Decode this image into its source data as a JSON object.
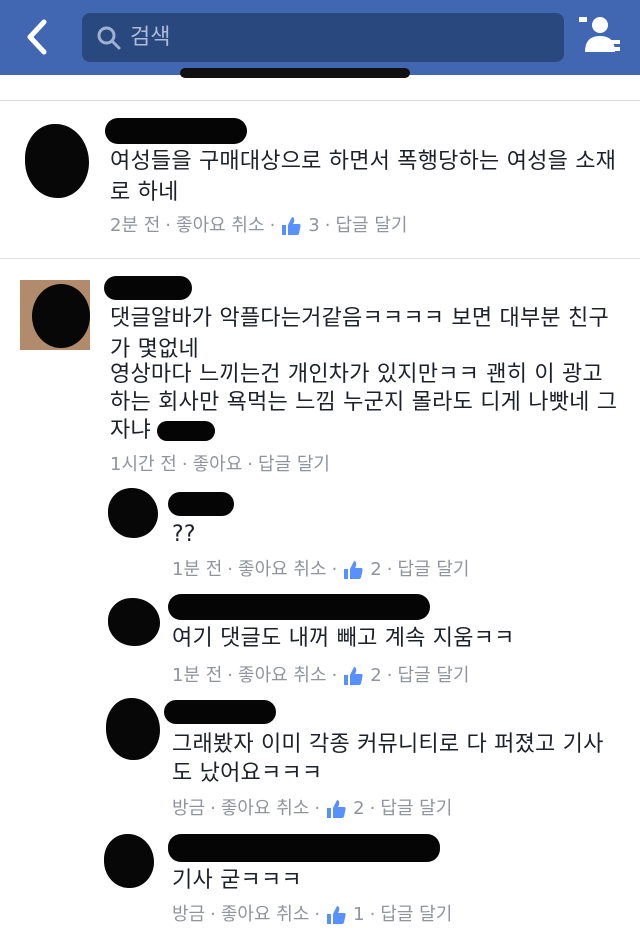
{
  "search": {
    "placeholder": "검색"
  },
  "comments": [
    {
      "lines": [
        "여성들을 구매대상으로 하면서 폭행당하는 여성을 소재",
        "로 하네"
      ],
      "time": "2분 전",
      "like": "좋아요 취소",
      "likes": "3",
      "reply": "답글 달기"
    },
    {
      "lines": [
        "댓글알바가 악플다는거같음ㅋㅋㅋㅋ 보면 대부분 친구",
        "가 몇없네",
        "영상마다 느끼는건 개인차가 있지만ㅋㅋ 괜히 이 광고",
        "하는 회사만 욕먹는 느낌 누군지 몰라도 디게 나빳네 그",
        "자냐"
      ],
      "time": "1시간 전",
      "like": "좋아요",
      "reply": "답글 달기",
      "replies": [
        {
          "lines": [
            "??"
          ],
          "time": "1분 전",
          "like": "좋아요 취소",
          "likes": "2",
          "reply": "답글 달기"
        },
        {
          "lines": [
            "여기 댓글도 내꺼 빼고 계속 지움ㅋㅋ"
          ],
          "time": "1분 전",
          "like": "좋아요 취소",
          "likes": "2",
          "reply": "답글 달기"
        },
        {
          "lines": [
            "그래봤자 이미 각종 커뮤니티로 다 퍼졌고 기사",
            "도 났어요ㅋㅋㅋ"
          ],
          "time": "방금",
          "like": "좋아요 취소",
          "likes": "2",
          "reply": "답글 달기"
        },
        {
          "lines": [
            "기사 굳ㅋㅋㅋ"
          ],
          "time": "방금",
          "like": "좋아요 취소",
          "likes": "1",
          "reply": "답글 달기"
        }
      ]
    }
  ]
}
